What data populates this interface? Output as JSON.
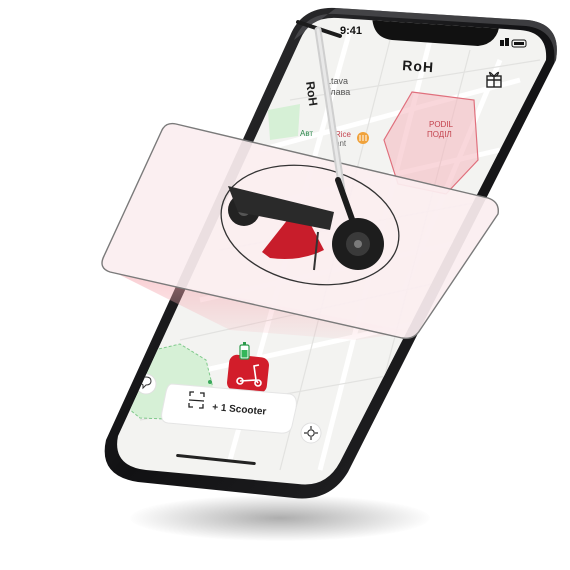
{
  "status_bar": {
    "time": "9:41"
  },
  "header": {
    "logo": "RoH",
    "gift_icon": "gift-icon"
  },
  "map": {
    "district_latin": "PODIL",
    "district_cyrillic": "ПОДІЛ",
    "street_1": "Ltava",
    "street_2": "Глава",
    "poi_label": "Rice",
    "poi_sub": "ant",
    "street_3": "Авт",
    "zone_color": "#f4b6bd",
    "park_color": "#d6f0d6"
  },
  "scooter_card": {
    "battery_icon": "battery-icon",
    "scooter_icon": "scooter-icon",
    "accent": "#d21d2a"
  },
  "bottom_bar": {
    "add_button_label": "+ 1 Scooter",
    "scan_icon": "scan-icon",
    "chat_icon": "chat-icon",
    "locate_icon": "locate-icon"
  },
  "scooter_branding": "RoH",
  "colors": {
    "brand_red": "#d21d2a",
    "panel_tint": "#fbeef0",
    "phone_frame": "#1b1b1d"
  }
}
